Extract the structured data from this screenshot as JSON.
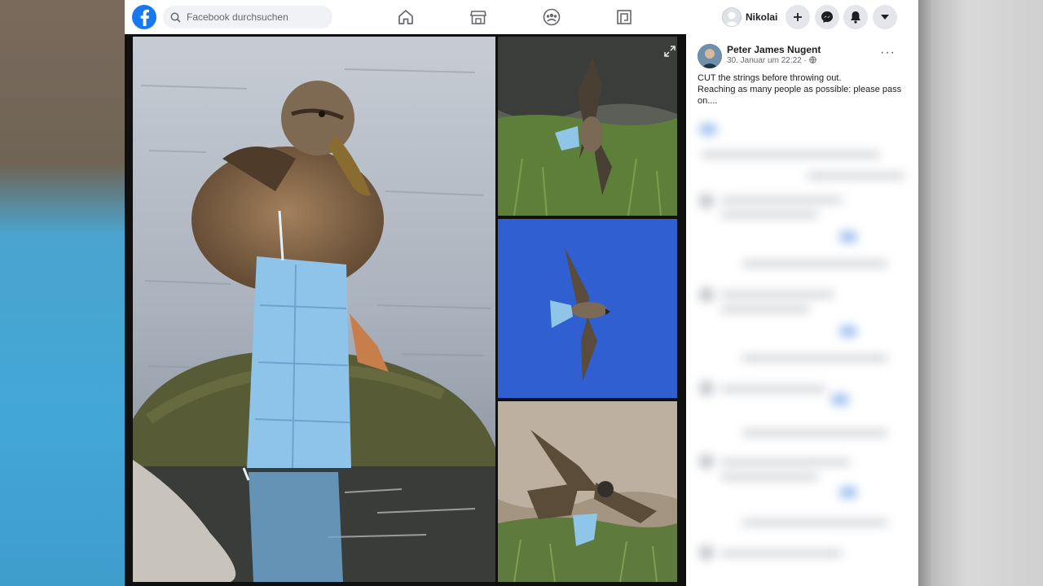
{
  "search": {
    "placeholder": "Facebook durchsuchen"
  },
  "user": {
    "name": "Nikolai"
  },
  "nav": {
    "icons": [
      "home-icon",
      "marketplace-icon",
      "groups-icon",
      "gaming-icon"
    ]
  },
  "actions": {
    "icons": [
      "plus-icon",
      "messenger-icon",
      "bell-icon",
      "caret-down-icon"
    ]
  },
  "post": {
    "author": "Peter James Nugent",
    "date": "30. Januar um 22:22 ·",
    "line1": "CUT the strings before throwing out.",
    "line2": "Reaching as many people as possible: please pass on....",
    "more": "···"
  },
  "colors": {
    "brand": "#1877f2",
    "sky": "#2f5fd0",
    "mask": "#8ec3ea"
  }
}
